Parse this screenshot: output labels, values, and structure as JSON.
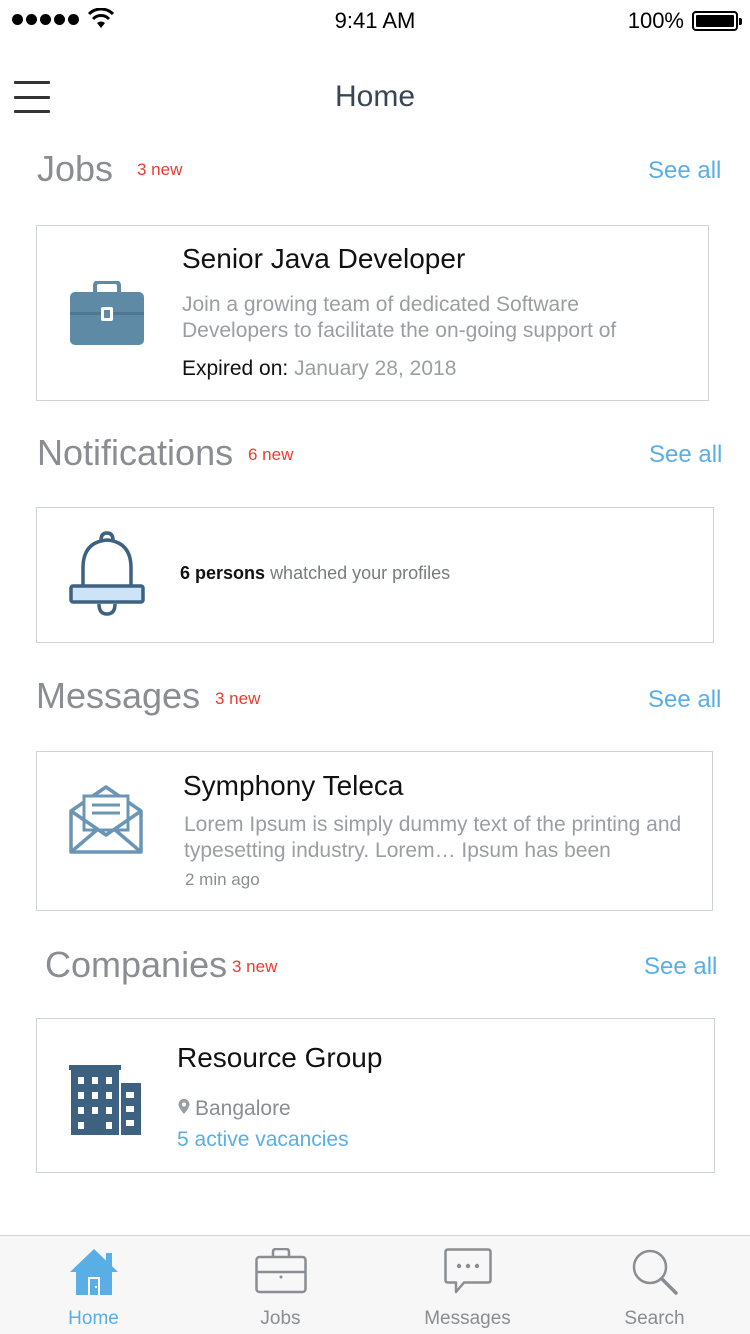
{
  "status_bar": {
    "time": "9:41 AM",
    "battery": "100%"
  },
  "nav": {
    "title": "Home"
  },
  "sections": {
    "jobs": {
      "title": "Jobs",
      "badge": "3 new",
      "see_all": "See all",
      "card": {
        "title": "Senior Java Developer",
        "description": "Join a growing team of dedicated Software Developers to facilitate the on-going support of",
        "expired_label": "Expired on:",
        "expired_date": "January 28, 2018"
      }
    },
    "notifications": {
      "title": "Notifications",
      "badge": "6 new",
      "see_all": "See all",
      "card": {
        "count_text": "6 persons",
        "rest_text": "whatched your profiles"
      }
    },
    "messages": {
      "title": "Messages",
      "badge": "3 new",
      "see_all": "See all",
      "card": {
        "title": "Symphony Teleca",
        "description": "Lorem Ipsum is simply dummy text of the printing and typesetting industry. Lorem… Ipsum has been",
        "time": "2 min ago"
      }
    },
    "companies": {
      "title": "Companies",
      "badge": "3 new",
      "see_all": "See all",
      "card": {
        "title": "Resource Group",
        "location": "Bangalore",
        "vacancies": "5 active vacancies"
      }
    }
  },
  "tabbar": {
    "items": [
      {
        "label": "Home",
        "icon": "home-icon",
        "active": true
      },
      {
        "label": "Jobs",
        "icon": "briefcase-icon",
        "active": false
      },
      {
        "label": "Messages",
        "icon": "chat-bubble-icon",
        "active": false
      },
      {
        "label": "Search",
        "icon": "search-icon",
        "active": false
      }
    ]
  },
  "colors": {
    "accent": "#5aaee6",
    "badge": "#ee3a32",
    "icon_primary": "#5f8aa6",
    "icon_dark": "#3d6180",
    "section_title": "#8a8d92"
  }
}
